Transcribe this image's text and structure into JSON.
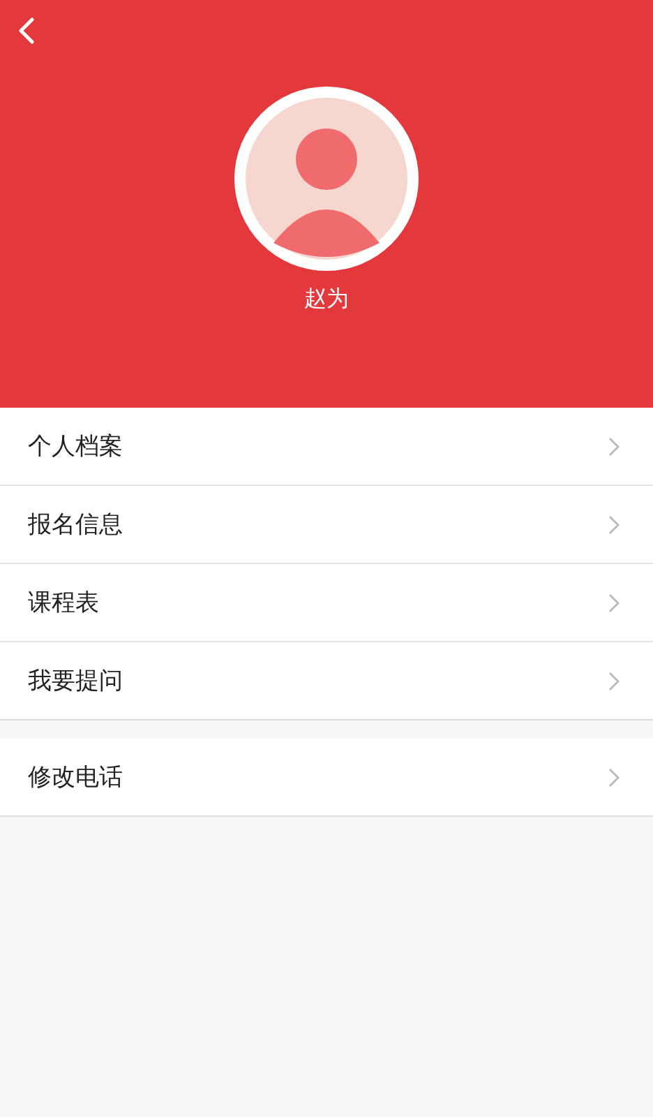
{
  "header": {
    "name": "赵为"
  },
  "menu_groups": [
    {
      "items": [
        {
          "label": "个人档案"
        },
        {
          "label": "报名信息"
        },
        {
          "label": "课程表"
        },
        {
          "label": "我要提问"
        }
      ]
    },
    {
      "items": [
        {
          "label": "修改电话"
        }
      ]
    }
  ]
}
